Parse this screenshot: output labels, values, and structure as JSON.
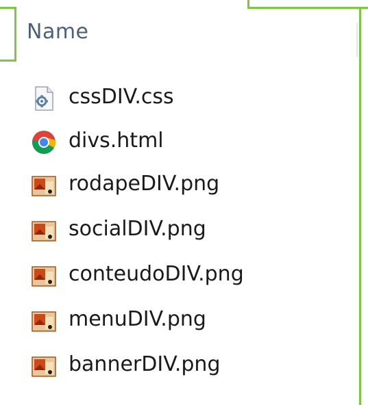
{
  "header": {
    "name_label": "Name"
  },
  "files": [
    {
      "name": "cssDIV.css",
      "icon": "css-file-icon"
    },
    {
      "name": "divs.html",
      "icon": "chrome-html-file-icon"
    },
    {
      "name": "rodapeDIV.png",
      "icon": "png-image-file-icon"
    },
    {
      "name": "socialDIV.png",
      "icon": "png-image-file-icon"
    },
    {
      "name": "conteudoDIV.png",
      "icon": "png-image-file-icon"
    },
    {
      "name": "menuDIV.png",
      "icon": "png-image-file-icon"
    },
    {
      "name": "bannerDIV.png",
      "icon": "png-image-file-icon"
    }
  ],
  "colors": {
    "outline_green": "#7cc741",
    "header_text": "#4c607a",
    "file_text": "#1a1a1a"
  }
}
